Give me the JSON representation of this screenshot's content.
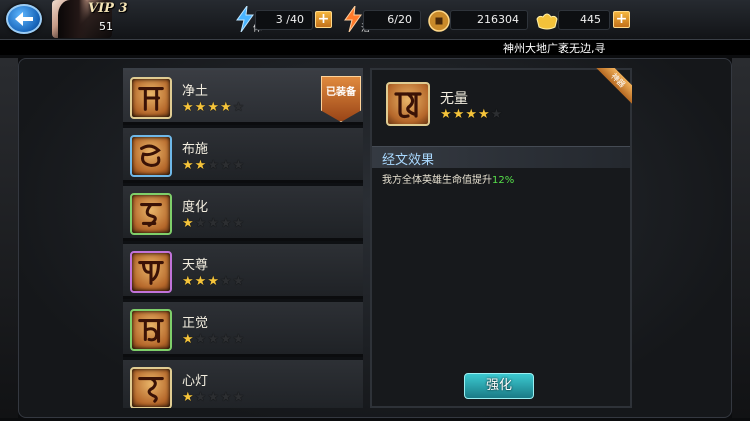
{
  "player": {
    "vip_label": "VIP 3",
    "level": "51"
  },
  "resources": {
    "stamina": {
      "icon": "lightning-blue-icon",
      "sub_label": "体",
      "value": "3 /40"
    },
    "energy": {
      "icon": "lightning-orange-icon",
      "sub_label": "活",
      "value": "6/20"
    },
    "coins": {
      "icon": "coin-icon",
      "value": "216304"
    },
    "ingots": {
      "icon": "gold-ingot-icon",
      "value": "445"
    }
  },
  "ticker": "神州大地广袤无边,寻",
  "scriptures": [
    {
      "name": "净土",
      "stars": 4,
      "frame": "gold",
      "equipped": true
    },
    {
      "name": "布施",
      "stars": 2,
      "frame": "blue",
      "equipped": false
    },
    {
      "name": "度化",
      "stars": 1,
      "frame": "green",
      "equipped": false
    },
    {
      "name": "天尊",
      "stars": 3,
      "frame": "purple",
      "equipped": false
    },
    {
      "name": "正觉",
      "stars": 1,
      "frame": "green",
      "equipped": false
    },
    {
      "name": "心灯",
      "stars": 1,
      "frame": "gold",
      "equipped": false
    }
  ],
  "equipped_tag": "已装备",
  "detail": {
    "name": "无量",
    "stars": 4,
    "corner_tag": "神器",
    "effect_title": "经文效果",
    "effect_text": "我方全体英雄生命值提升",
    "effect_value": "12%",
    "enhance_label": "强化"
  },
  "colors": {
    "accent_gold": "#f5c43b",
    "effect_green": "#56e04a",
    "button_teal": "#2aa5ae"
  }
}
